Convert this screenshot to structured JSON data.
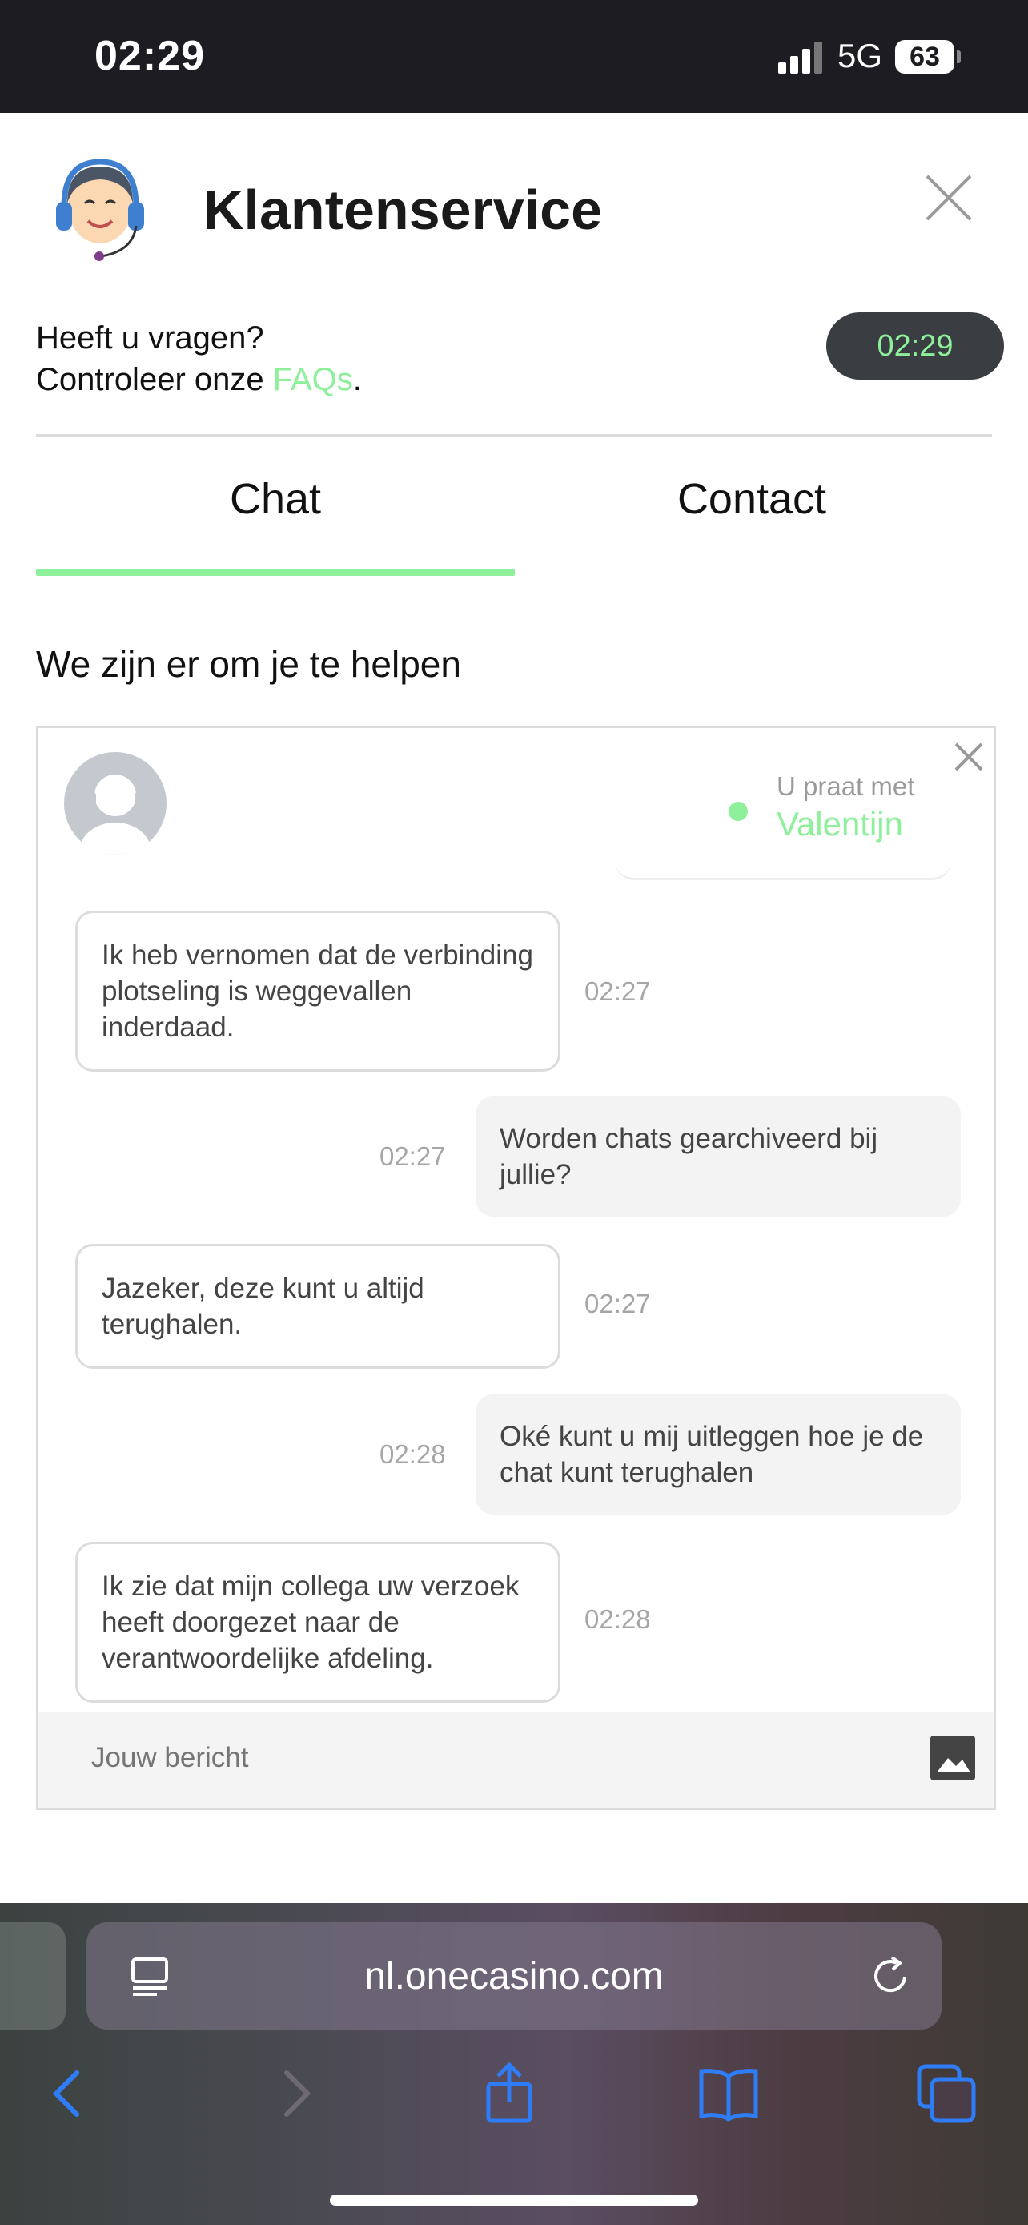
{
  "status_bar": {
    "time": "02:29",
    "network": "5G",
    "battery": "63"
  },
  "header": {
    "title": "Klantenservice"
  },
  "faq": {
    "line1": "Heeft u vragen?",
    "line2_prefix": "Controleer onze ",
    "link": "FAQs",
    "line2_suffix": "."
  },
  "timer": "02:29",
  "tabs": [
    {
      "label": "Chat",
      "active": true
    },
    {
      "label": "Contact",
      "active": false
    }
  ],
  "helper_text": "We zijn er om je te helpen",
  "chat": {
    "talking_with_label": "U praat met",
    "agent_name": "Valentijn",
    "messages": [
      {
        "from": "agent",
        "text": "Ik heb vernomen dat de verbinding plotseling is weggevallen inderdaad.",
        "time": "02:27"
      },
      {
        "from": "user",
        "text": "Worden chats gearchiveerd bij jullie?",
        "time": "02:27"
      },
      {
        "from": "agent",
        "text": "Jazeker, deze kunt u altijd terughalen.",
        "time": "02:27"
      },
      {
        "from": "user",
        "text": "Oké kunt u mij uitleggen hoe je de chat kunt terughalen",
        "time": "02:28"
      },
      {
        "from": "agent",
        "text": "Ik zie dat mijn collega uw verzoek heeft doorgezet naar de verantwoordelijke afdeling.",
        "time": "02:28"
      }
    ],
    "input_placeholder": "Jouw bericht"
  },
  "browser": {
    "url": "nl.onecasino.com"
  },
  "colors": {
    "accent": "#8ef09b",
    "pill_bg": "#3a3d42",
    "ios_blue": "#2f7df6"
  },
  "icons": [
    "agent-headset-icon",
    "close-icon",
    "agent-avatar-icon",
    "image-upload-icon",
    "reader-icon",
    "reload-icon",
    "back-icon",
    "forward-icon",
    "share-icon",
    "bookmarks-icon",
    "tabs-icon"
  ]
}
